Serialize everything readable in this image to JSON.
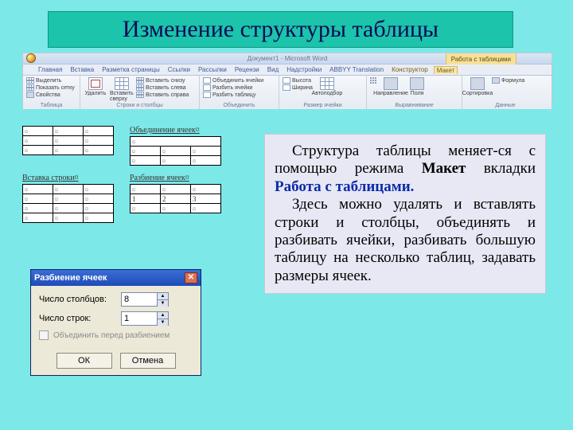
{
  "title": "Изменение структуры таблицы",
  "word": {
    "doc_title": "Документ1 - Microsoft Word",
    "tools_group": "Работа с таблицами",
    "tabs": [
      "Главная",
      "Вставка",
      "Разметка страницы",
      "Ссылки",
      "Рассылки",
      "Рецензи",
      "Вид",
      "Надстройки",
      "ABBYY Translation"
    ],
    "tab_design": "Конструктор",
    "tab_layout": "Макет",
    "groups": {
      "table": {
        "label": "Таблица",
        "select": "Выделить",
        "grid": "Показать сетку",
        "props": "Свойства"
      },
      "rowscols": {
        "label": "Строки и столбцы",
        "delete": "Удалить",
        "ins_top": "Вставить сверху",
        "ins_bottom": "Вставить снизу",
        "ins_left": "Вставить слева",
        "ins_right": "Вставить справа"
      },
      "merge": {
        "label": "Объединить",
        "merge": "Объединить ячейки",
        "split": "Разбить ячейки",
        "split_tbl": "Разбить таблицу"
      },
      "size": {
        "label": "Размер ячейки",
        "h": "Высота",
        "w": "Ширина",
        "auto": "Автоподбор"
      },
      "align": {
        "label": "Выравнивание",
        "dir": "Направление",
        "marg": "Поля"
      },
      "data": {
        "label": "Данные",
        "sort": "Сортировка",
        "fx": "Формула"
      }
    }
  },
  "examples": {
    "merge_label": "Объединение ячеек¤",
    "insert_label": "Вставка строки¤",
    "split_label": "Разбиение ячеек¤"
  },
  "dialog": {
    "title": "Разбиение ячеек",
    "cols_label": "Число столбцов:",
    "rows_label": "Число строк:",
    "cols_value": "8",
    "rows_value": "1",
    "checkbox": "Объединить перед разбиением",
    "ok": "ОК",
    "cancel": "Отмена"
  },
  "body": {
    "p1a": "Структура таблицы  меняет-ся с помощью режима ",
    "maket": "Макет",
    "p1b": " вкладки ",
    "worktab": "Работа с таблицами.",
    "p2": "Здесь можно удалять и вставлять строки и столбцы, объединять и разбивать ячейки, разбивать большую таблицу на несколько таблиц, задавать размеры ячеек."
  }
}
